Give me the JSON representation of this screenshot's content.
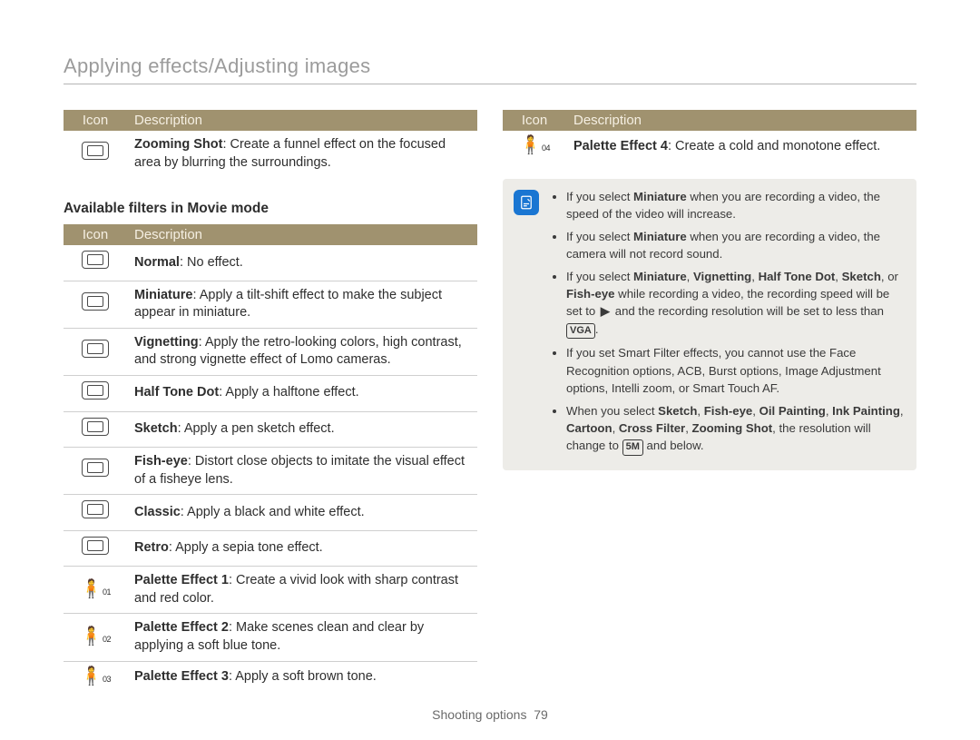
{
  "page_title": "Applying effects/Adjusting images",
  "footer": {
    "label": "Shooting options",
    "page": "79"
  },
  "table_header": {
    "icon": "Icon",
    "desc": "Description"
  },
  "left_top_table": [
    {
      "icon": "zoom-shot-icon",
      "desc": [
        {
          "strong": true,
          "text": "Zooming Shot"
        },
        {
          "strong": false,
          "text": ": Create a funnel effect on the focused area by blurring the surroundings."
        }
      ]
    }
  ],
  "movie_filters_heading": "Available filters in Movie mode",
  "left_movie_table": [
    {
      "icon": "normal-off-icon",
      "desc": [
        {
          "strong": true,
          "text": "Normal"
        },
        {
          "strong": false,
          "text": ": No effect."
        }
      ]
    },
    {
      "icon": "miniature-icon",
      "desc": [
        {
          "strong": true,
          "text": "Miniature"
        },
        {
          "strong": false,
          "text": ": Apply a tilt-shift effect to make the subject appear in miniature."
        }
      ]
    },
    {
      "icon": "vignetting-icon",
      "desc": [
        {
          "strong": true,
          "text": "Vignetting"
        },
        {
          "strong": false,
          "text": ": Apply the retro-looking colors, high contrast, and strong vignette effect of Lomo cameras."
        }
      ]
    },
    {
      "icon": "halftone-icon",
      "desc": [
        {
          "strong": true,
          "text": "Half Tone Dot"
        },
        {
          "strong": false,
          "text": ": Apply a halftone effect."
        }
      ]
    },
    {
      "icon": "sketch-icon",
      "desc": [
        {
          "strong": true,
          "text": "Sketch"
        },
        {
          "strong": false,
          "text": ": Apply a pen sketch effect."
        }
      ]
    },
    {
      "icon": "fisheye-icon",
      "desc": [
        {
          "strong": true,
          "text": "Fish-eye"
        },
        {
          "strong": false,
          "text": ": Distort close objects to imitate the visual effect of a fisheye lens."
        }
      ]
    },
    {
      "icon": "classic-icon",
      "desc": [
        {
          "strong": true,
          "text": "Classic"
        },
        {
          "strong": false,
          "text": ": Apply a black and white effect."
        }
      ]
    },
    {
      "icon": "retro-icon",
      "desc": [
        {
          "strong": true,
          "text": "Retro"
        },
        {
          "strong": false,
          "text": ": Apply a sepia tone effect."
        }
      ]
    },
    {
      "icon": "palette1-icon",
      "person_sub": "01",
      "desc": [
        {
          "strong": true,
          "text": "Palette Effect 1"
        },
        {
          "strong": false,
          "text": ": Create a vivid look with sharp contrast and red color."
        }
      ]
    },
    {
      "icon": "palette2-icon",
      "person_sub": "02",
      "desc": [
        {
          "strong": true,
          "text": "Palette Effect 2"
        },
        {
          "strong": false,
          "text": ": Make scenes clean and clear by applying a soft blue tone."
        }
      ]
    },
    {
      "icon": "palette3-icon",
      "person_sub": "03",
      "desc": [
        {
          "strong": true,
          "text": "Palette Effect 3"
        },
        {
          "strong": false,
          "text": ": Apply a soft brown tone."
        }
      ]
    }
  ],
  "right_top_table": [
    {
      "icon": "palette4-icon",
      "person_sub": "04",
      "desc": [
        {
          "strong": true,
          "text": "Palette Effect 4"
        },
        {
          "strong": false,
          "text": ": Create a cold and monotone effect."
        }
      ]
    }
  ],
  "note_items": [
    [
      {
        "text": "If you select "
      },
      {
        "strong": true,
        "text": "Miniature"
      },
      {
        "text": " when you are recording a video, the speed of the video will increase."
      }
    ],
    [
      {
        "text": "If you select "
      },
      {
        "strong": true,
        "text": "Miniature"
      },
      {
        "text": " when you are recording a video, the camera will not record sound."
      }
    ],
    [
      {
        "text": "If you select "
      },
      {
        "strong": true,
        "text": "Miniature"
      },
      {
        "text": ", "
      },
      {
        "strong": true,
        "text": "Vignetting"
      },
      {
        "text": ", "
      },
      {
        "strong": true,
        "text": "Half Tone Dot"
      },
      {
        "text": ", "
      },
      {
        "strong": true,
        "text": "Sketch"
      },
      {
        "text": ", or "
      },
      {
        "strong": true,
        "text": "Fish-eye"
      },
      {
        "text": " while recording a video, the recording speed will be set to "
      },
      {
        "glyph": "rec-speed-icon",
        "text": ""
      },
      {
        "text": " and the recording resolution will be set to less than "
      },
      {
        "glyph": "vga-icon",
        "text": "VGA"
      },
      {
        "text": "."
      }
    ],
    [
      {
        "text": "If you set Smart Filter effects, you cannot use the Face Recognition options, ACB, Burst options, Image Adjustment options, Intelli zoom, or Smart Touch AF."
      }
    ],
    [
      {
        "text": "When you select "
      },
      {
        "strong": true,
        "text": "Sketch"
      },
      {
        "text": ", "
      },
      {
        "strong": true,
        "text": "Fish-eye"
      },
      {
        "text": ", "
      },
      {
        "strong": true,
        "text": "Oil Painting"
      },
      {
        "text": ", "
      },
      {
        "strong": true,
        "text": "Ink Painting"
      },
      {
        "text": ", "
      },
      {
        "strong": true,
        "text": "Cartoon"
      },
      {
        "text": ", "
      },
      {
        "strong": true,
        "text": "Cross Filter"
      },
      {
        "text": ", "
      },
      {
        "strong": true,
        "text": "Zooming Shot"
      },
      {
        "text": ", the resolution will change to "
      },
      {
        "glyph": "5m-icon",
        "text": "5M"
      },
      {
        "text": " and below."
      }
    ]
  ]
}
